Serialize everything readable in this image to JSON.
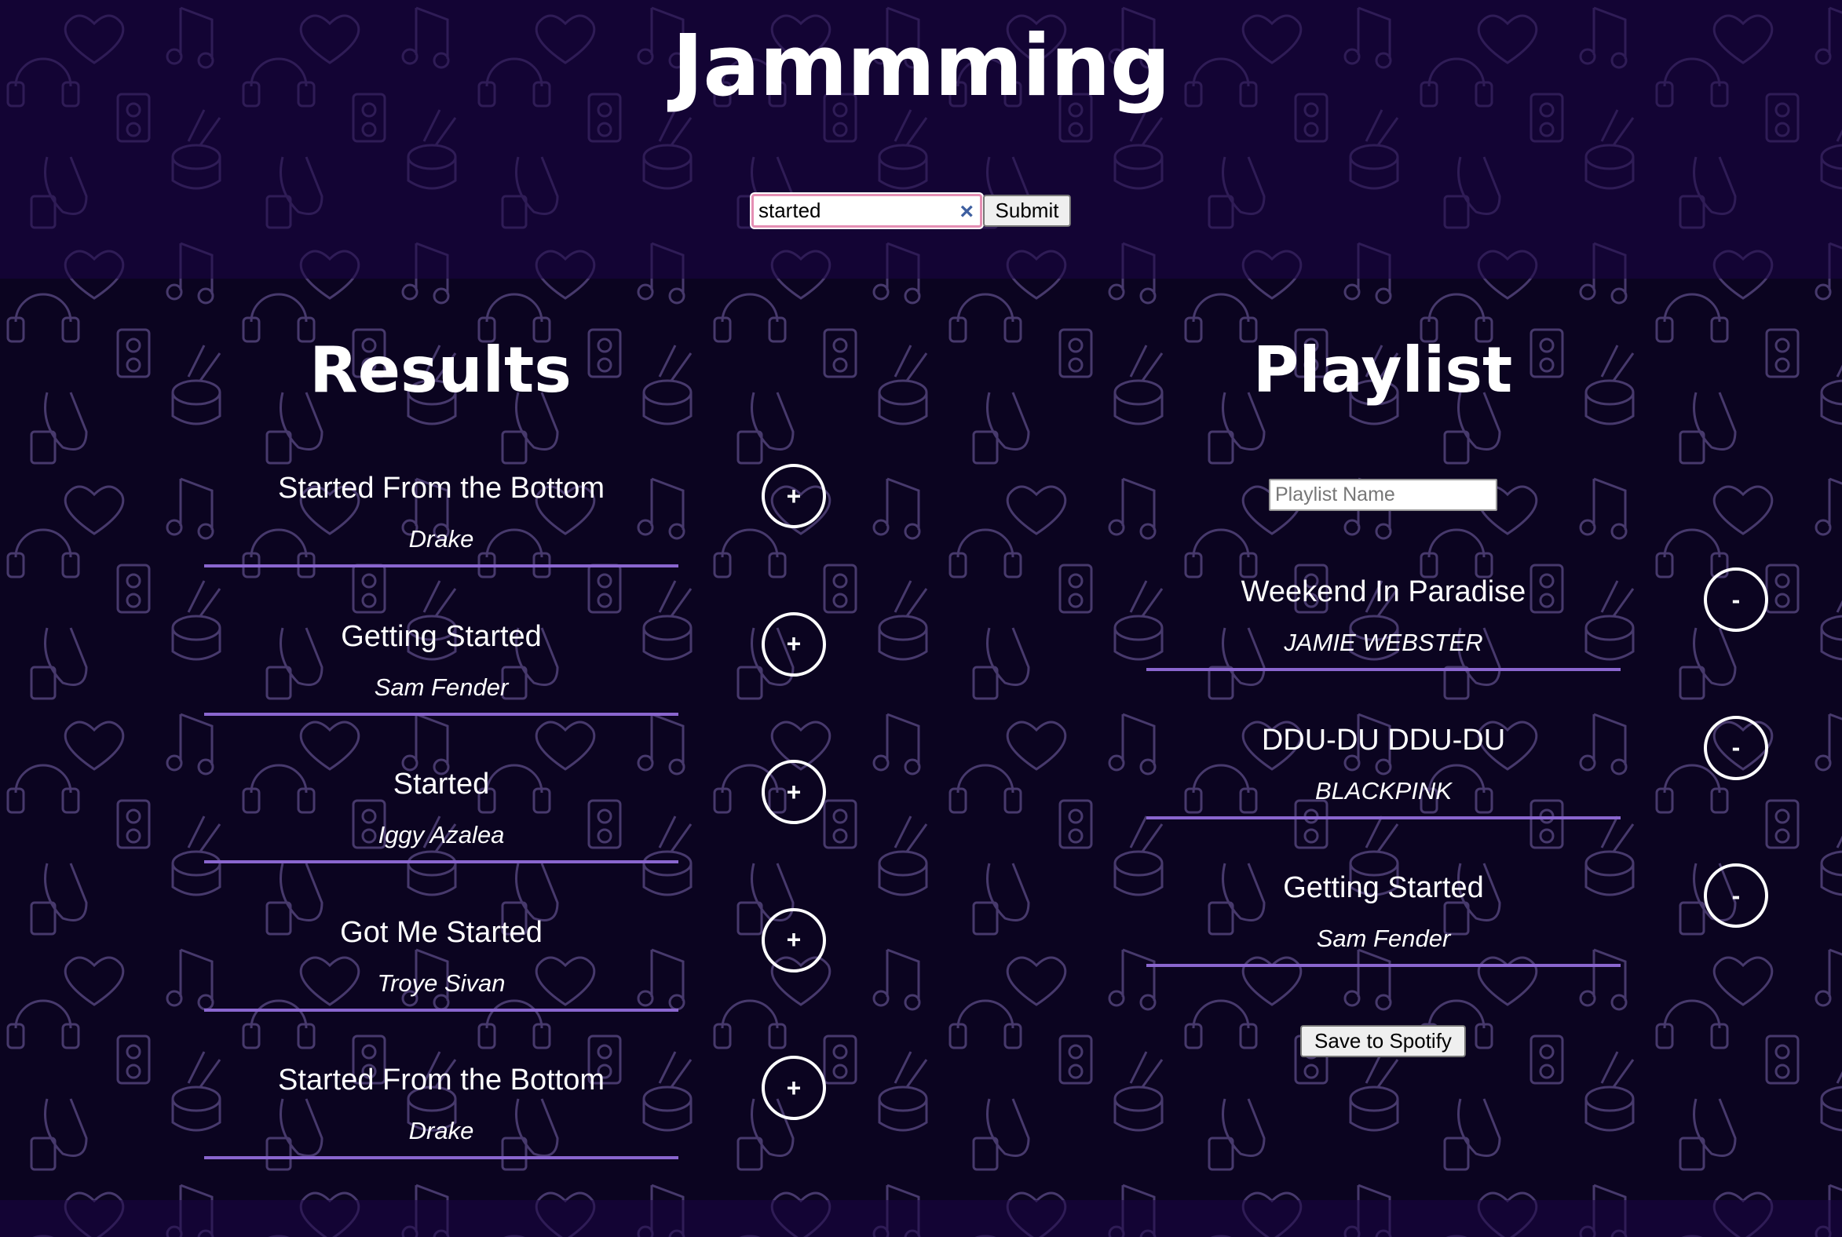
{
  "app": {
    "title": "Jammming"
  },
  "search": {
    "value": "started",
    "clear_icon": "×",
    "submit_label": "Submit"
  },
  "results": {
    "heading": "Results",
    "add_symbol": "+",
    "tracks": [
      {
        "name": "Started From the Bottom",
        "artist": "Drake"
      },
      {
        "name": "Getting Started",
        "artist": "Sam Fender"
      },
      {
        "name": "Started",
        "artist": "Iggy Azalea"
      },
      {
        "name": "Got Me Started",
        "artist": "Troye Sivan"
      },
      {
        "name": "Started From the Bottom",
        "artist": "Drake"
      }
    ]
  },
  "playlist": {
    "heading": "Playlist",
    "name_placeholder": "Playlist Name",
    "remove_symbol": "-",
    "tracks": [
      {
        "name": "Weekend In Paradise",
        "artist": "JAMIE WEBSTER"
      },
      {
        "name": "DDU-DU DDU-DU",
        "artist": "BLACKPINK"
      },
      {
        "name": "Getting Started",
        "artist": "Sam Fender"
      }
    ],
    "save_label": "Save to Spotify"
  },
  "colors": {
    "accent": "#8a66cf",
    "header_bg": "#170538",
    "main_bg": "#0b0420",
    "search_border": "#e58fb4"
  }
}
